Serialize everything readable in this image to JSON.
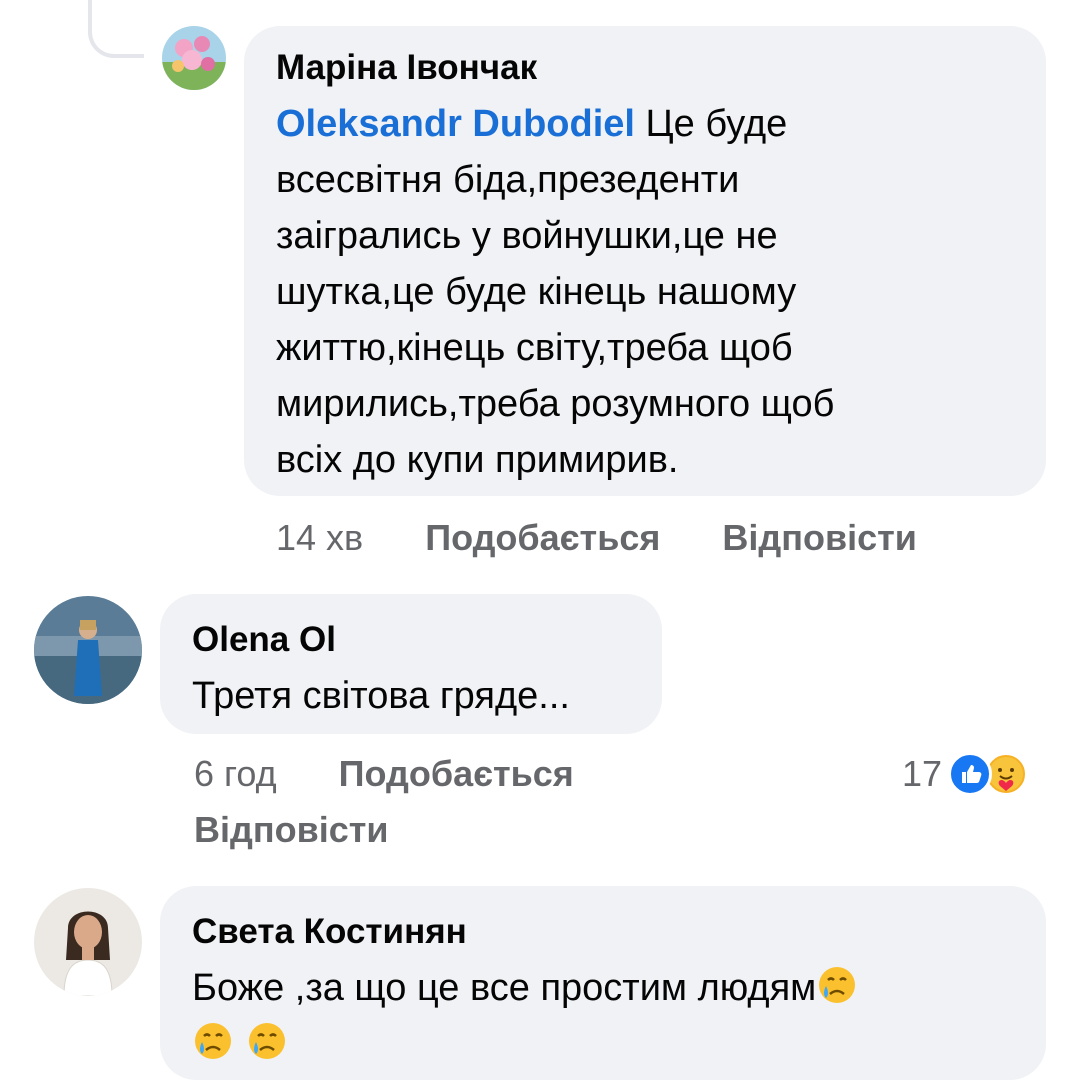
{
  "comments": [
    {
      "author": "Маріна Івончак",
      "mention": "Oleksandr Dubodiel",
      "text_lines": [
        " Це буде",
        "всесвітня біда,презеденти",
        "заігрались у войнушки,це не",
        "шутка,це буде кінець нашому",
        "життю,кінець світу,треба щоб",
        "мирились,треба розумного щоб",
        "всіх до купи примирив."
      ],
      "time": "14 хв",
      "like_label": "Подобається",
      "reply_label": "Відповісти"
    },
    {
      "author": "Olena Ol",
      "text": "Третя світова гряде...",
      "time": "6 год",
      "like_label": "Подобається",
      "reply_label": "Відповісти",
      "reaction_count": "17",
      "reaction_icons": [
        "like-icon",
        "care-icon"
      ]
    },
    {
      "author": "Света Костинян",
      "text": "Боже ,за що це все простим людям",
      "emoji": "crying-face-icon"
    }
  ],
  "colors": {
    "bubble": "#f0f2f5",
    "mention": "#1a6fd6",
    "meta": "#65676b",
    "like_blue": "#1877f2"
  }
}
